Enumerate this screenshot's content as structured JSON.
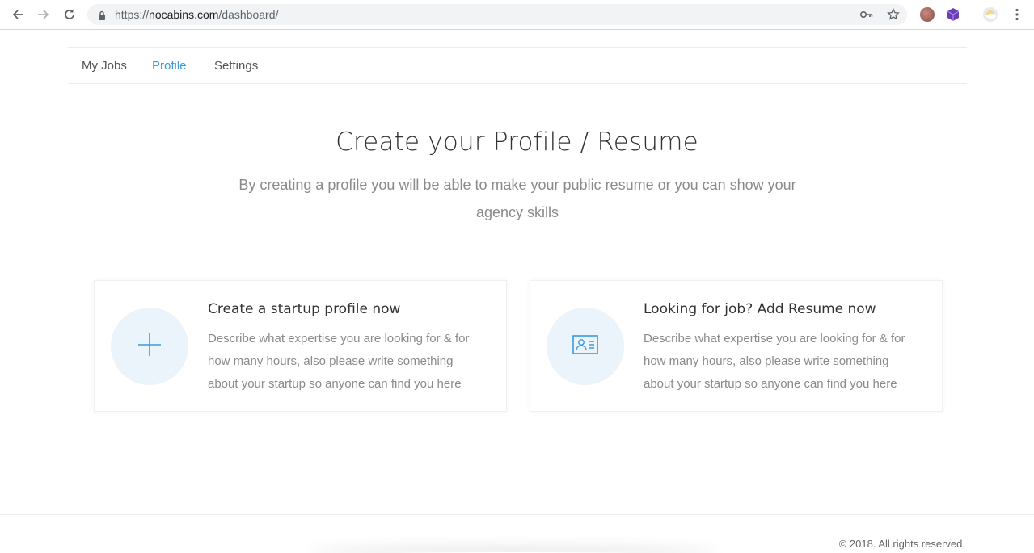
{
  "browser": {
    "url_scheme": "https://",
    "url_host": "nocabins.com",
    "url_path": "/dashboard/"
  },
  "tabs": [
    {
      "label": "My Jobs",
      "active": false
    },
    {
      "label": "Profile",
      "active": true
    },
    {
      "label": "Settings",
      "active": false
    }
  ],
  "hero": {
    "title": "Create your Profile / Resume",
    "subtitle": "By creating a profile you will be able to make your public resume or you can show your agency skills"
  },
  "cards": [
    {
      "title": "Create a startup profile now",
      "description": "Describe what expertise you are looking for & for how many hours, also please write something about your startup so anyone can find you here",
      "icon": "plus-icon"
    },
    {
      "title": "Looking for job? Add Resume now",
      "description": "Describe what expertise you are looking for & for how many hours, also please write something about your startup so anyone can find you here",
      "icon": "id-card-icon"
    }
  ],
  "footer": {
    "copyright": "© 2018. All rights reserved."
  },
  "colors": {
    "accent": "#3a9bdc",
    "icon_circle_bg": "#ebf3fb"
  }
}
